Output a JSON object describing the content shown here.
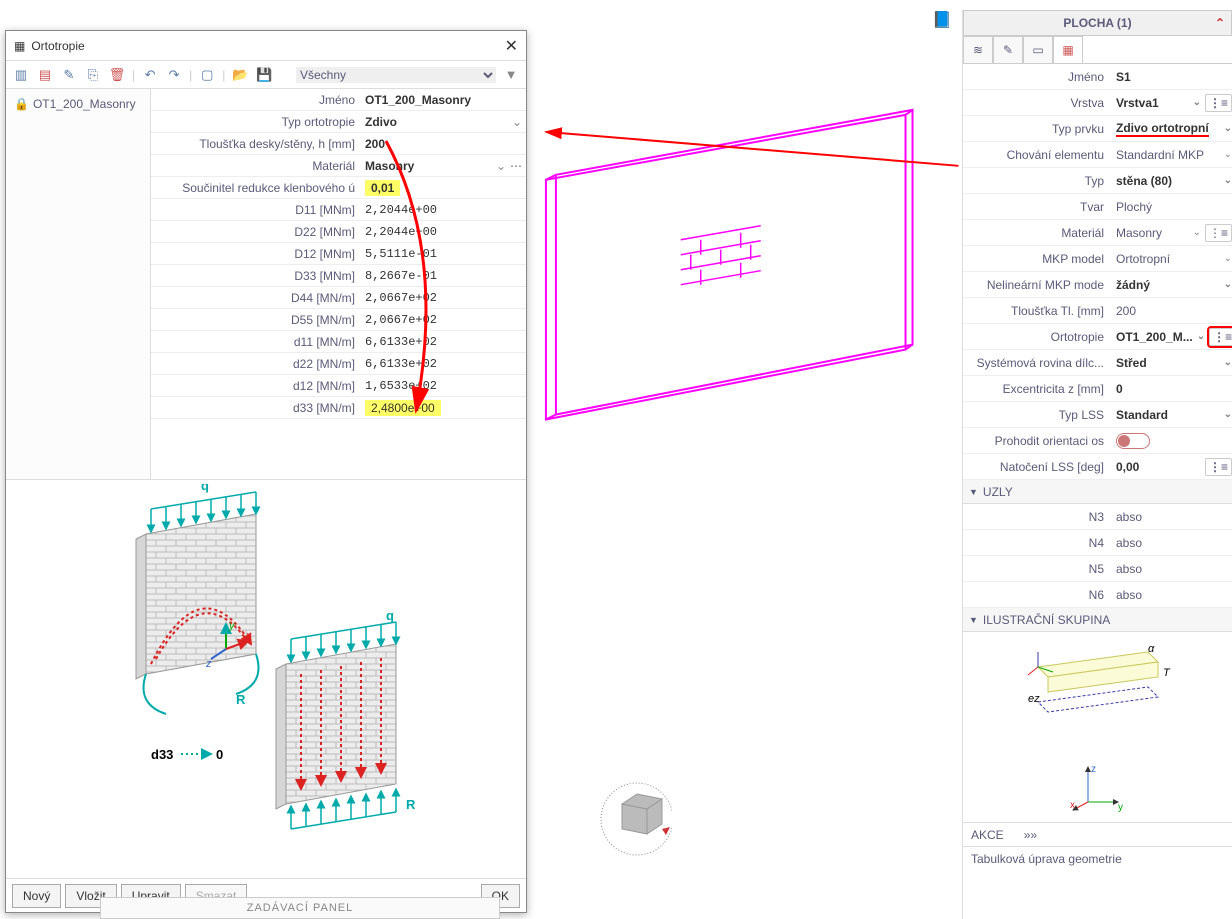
{
  "dialog": {
    "title": "Ortotropie",
    "filter_label": "Všechny",
    "left_item": "OT1_200_Masonry",
    "props": {
      "jmeno_l": "Jméno",
      "jmeno_v": "OT1_200_Masonry",
      "typ_l": "Typ ortotropie",
      "typ_v": "Zdivo",
      "tl_l": "Tloušťka desky/stěny, h [mm]",
      "tl_v": "200",
      "mat_l": "Materiál",
      "mat_v": "Masonry",
      "soucin_l": "Součinitel redukce klenbového ú",
      "soucin_v": "0,01",
      "d11b_l": "D11 [MNm]",
      "d11b_v": "2,2044e+00",
      "d22b_l": "D22 [MNm]",
      "d22b_v": "2,2044e+00",
      "d12b_l": "D12 [MNm]",
      "d12b_v": "5,5111e-01",
      "d33b_l": "D33 [MNm]",
      "d33b_v": "8,2667e-01",
      "d44_l": "D44 [MN/m]",
      "d44_v": "2,0667e+02",
      "d55_l": "D55 [MN/m]",
      "d55_v": "2,0667e+02",
      "d11_l": "d11 [MN/m]",
      "d11_v": "6,6133e+02",
      "d22_l": "d22 [MN/m]",
      "d22_v": "6,6133e+02",
      "d12_l": "d12 [MN/m]",
      "d12_v": "1,6533e+02",
      "d33_l": "d33 [MN/m]",
      "d33_v": "2,4800e+00"
    },
    "illus": {
      "q1": "q",
      "r1": "R",
      "q2": "q",
      "r2": "R",
      "d33": "d33",
      "zero": "0",
      "x": "x",
      "y": "y",
      "z": "z"
    },
    "buttons": {
      "novy": "Nový",
      "vlozit": "Vložit",
      "upravit": "Upravit",
      "smazat": "Smazat",
      "ok": "OK"
    }
  },
  "panel": {
    "title": "PLOCHA (1)",
    "rows": {
      "jmeno_l": "Jméno",
      "jmeno_v": "S1",
      "vrstva_l": "Vrstva",
      "vrstva_v": "Vrstva1",
      "typprvku_l": "Typ prvku",
      "typprvku_v": "Zdivo ortotropní",
      "chova_l": "Chování elementu",
      "chova_v": "Standardní MKP",
      "typ_l": "Typ",
      "typ_v": "stěna (80)",
      "tvar_l": "Tvar",
      "tvar_v": "Plochý",
      "mat_l": "Materiál",
      "mat_v": "Masonry",
      "mkp_l": "MKP model",
      "mkp_v": "Ortotropní",
      "nelin_l": "Nelineární MKP mode",
      "nelin_v": "žádný",
      "tlou_l": "Tloušťka Tl. [mm]",
      "tlou_v": "200",
      "orto_l": "Ortotropie",
      "orto_v": "OT1_200_M...",
      "sys_l": "Systémová rovina dílc...",
      "sys_v": "Střed",
      "exc_l": "Excentricita z [mm]",
      "exc_v": "0",
      "lss_l": "Typ LSS",
      "lss_v": "Standard",
      "prohod_l": "Prohodit orientaci os",
      "natoc_l": "Natočení LSS [deg]",
      "natoc_v": "0,00"
    },
    "sections": {
      "uzly": "UZLY",
      "ilus": "ILUSTRAČNÍ SKUPINA",
      "akce": "AKCE"
    },
    "nodes": {
      "n3_l": "N3",
      "n3_v": "abso",
      "n4_l": "N4",
      "n4_v": "abso",
      "n5_l": "N5",
      "n5_v": "abso",
      "n6_l": "N6",
      "n6_v": "abso"
    },
    "illus": {
      "alpha": "α",
      "t": "T",
      "ez": "ez",
      "x": "x",
      "y": "y",
      "z": "z"
    },
    "akce_arrow": "»»",
    "akce_text": "Tabulková úprava geometrie"
  },
  "bottom_bar": "ZADÁVACÍ PANEL"
}
